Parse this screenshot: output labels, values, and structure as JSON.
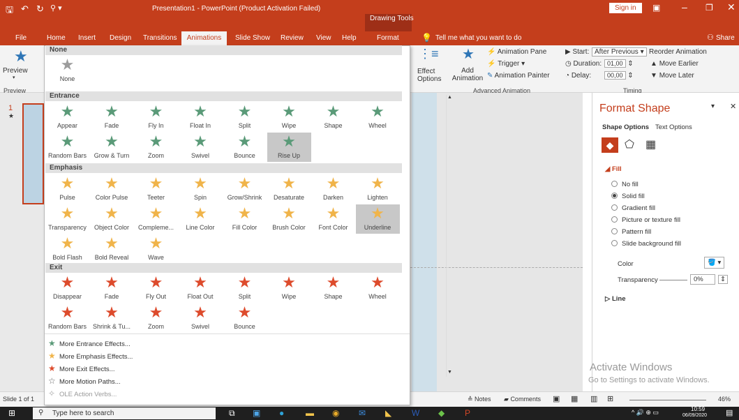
{
  "titlebar": {
    "title": "Presentation1 - PowerPoint (Product Activation Failed)",
    "contextual_tab": "Drawing Tools",
    "sign_in": "Sign in",
    "share": "Share"
  },
  "tabs": [
    "File",
    "Home",
    "Insert",
    "Design",
    "Transitions",
    "Animations",
    "Slide Show",
    "Review",
    "View",
    "Help",
    "Format"
  ],
  "tell_me": "Tell me what you want to do",
  "ribbon": {
    "preview": "Preview",
    "preview_group": "Preview",
    "effect_options": "Effect Options",
    "add_animation": "Add Animation",
    "animation_pane": "Animation Pane",
    "trigger": "Trigger",
    "animation_painter": "Animation Painter",
    "advanced_group": "Advanced Animation",
    "start_label": "Start:",
    "start_value": "After Previous",
    "duration_label": "Duration:",
    "duration_value": "01,00",
    "delay_label": "Delay:",
    "delay_value": "00,00",
    "reorder": "Reorder Animation",
    "move_earlier": "Move Earlier",
    "move_later": "Move Later",
    "timing_group": "Timing"
  },
  "gallery": {
    "none_header": "None",
    "none_item": "None",
    "entrance_header": "Entrance",
    "entrance": [
      "Appear",
      "Fade",
      "Fly In",
      "Float In",
      "Split",
      "Wipe",
      "Shape",
      "Wheel",
      "Random Bars",
      "Grow & Turn",
      "Zoom",
      "Swivel",
      "Bounce",
      "Rise Up"
    ],
    "emphasis_header": "Emphasis",
    "emphasis": [
      "Pulse",
      "Color Pulse",
      "Teeter",
      "Spin",
      "Grow/Shrink",
      "Desaturate",
      "Darken",
      "Lighten",
      "Transparency",
      "Object Color",
      "Compleme...",
      "Line Color",
      "Fill Color",
      "Brush Color",
      "Font Color",
      "Underline",
      "Bold Flash",
      "Bold Reveal",
      "Wave"
    ],
    "exit_header": "Exit",
    "exit": [
      "Disappear",
      "Fade",
      "Fly Out",
      "Float Out",
      "Split",
      "Wipe",
      "Shape",
      "Wheel",
      "Random Bars",
      "Shrink & Tu...",
      "Zoom",
      "Swivel",
      "Bounce"
    ],
    "more": [
      "More Entrance Effects...",
      "More Emphasis Effects...",
      "More Exit Effects...",
      "More Motion Paths...",
      "OLE Action Verbs..."
    ]
  },
  "format_pane": {
    "title": "Format Shape",
    "tab_shape": "Shape Options",
    "tab_text": "Text Options",
    "fill_header": "Fill",
    "fill_options": [
      "No fill",
      "Solid fill",
      "Gradient fill",
      "Picture or texture fill",
      "Pattern fill",
      "Slide background fill"
    ],
    "selected_fill": "Solid fill",
    "color_label": "Color",
    "transparency_label": "Transparency",
    "transparency_value": "0%",
    "line_header": "Line"
  },
  "watermark": {
    "line1": "Activate Windows",
    "line2": "Go to Settings to activate Windows."
  },
  "status": {
    "slide": "Slide 1 of 1",
    "notes": "Notes",
    "comments": "Comments",
    "zoom": "46%"
  },
  "taskbar": {
    "search": "Type here to search",
    "time": "10:59",
    "date": "06/09/2020"
  },
  "colors": {
    "accent": "#c43e1c",
    "entrance": "#5a9a78",
    "emphasis": "#f0b44a",
    "exit": "#dd4b2c"
  }
}
